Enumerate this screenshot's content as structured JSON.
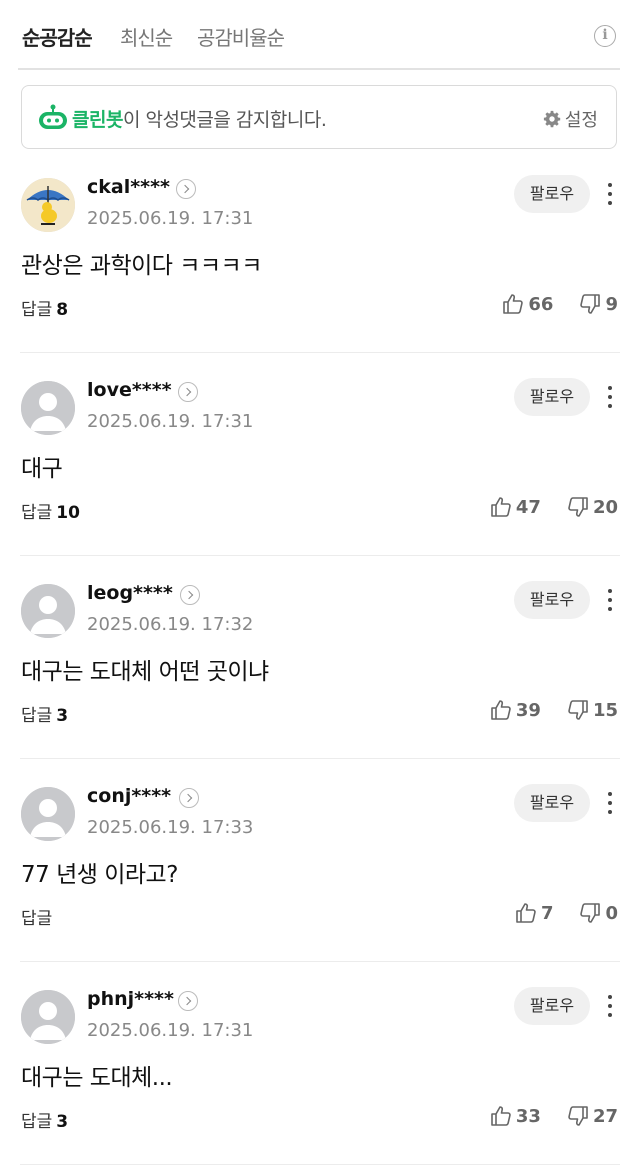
{
  "tabs": [
    {
      "label": "순공감순",
      "active": true
    },
    {
      "label": "최신순",
      "active": false
    },
    {
      "label": "공감비율순",
      "active": false
    }
  ],
  "info_icon": "info-icon",
  "cleanbot": {
    "brand": "클린봇",
    "message": "이 악성댓글을 감지합니다.",
    "setting_label": "설정",
    "brand_color": "#1bb466"
  },
  "follow_label": "팔로우",
  "reply_label": "답글",
  "comments": [
    {
      "user": "ckal****",
      "date": "2025.06.19. 17:31",
      "text": "관상은 과학이다 ㅋㅋㅋㅋ",
      "replies": "8",
      "likes": "66",
      "dislikes": "9",
      "avatar": "custom"
    },
    {
      "user": "love****",
      "date": "2025.06.19. 17:31",
      "text": "대구",
      "replies": "10",
      "likes": "47",
      "dislikes": "20",
      "avatar": "default"
    },
    {
      "user": "leog****",
      "date": "2025.06.19. 17:32",
      "text": "대구는 도대체 어떤 곳이냐",
      "replies": "3",
      "likes": "39",
      "dislikes": "15",
      "avatar": "default"
    },
    {
      "user": "conj****",
      "date": "2025.06.19. 17:33",
      "text": "77 년생 이라고?",
      "replies": "",
      "likes": "7",
      "dislikes": "0",
      "avatar": "default"
    },
    {
      "user": "phnj****",
      "date": "2025.06.19. 17:31",
      "text": "대구는 도대체...",
      "replies": "3",
      "likes": "33",
      "dislikes": "27",
      "avatar": "default"
    }
  ]
}
